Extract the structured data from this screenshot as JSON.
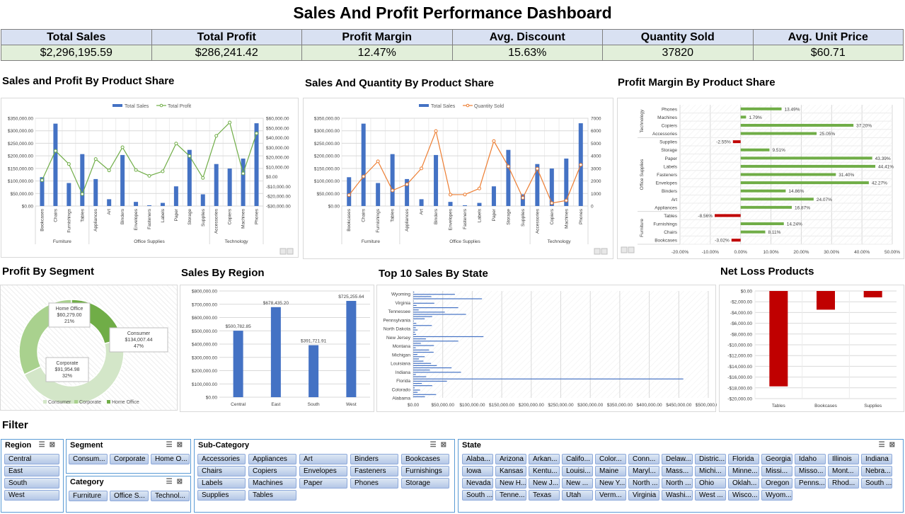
{
  "title": "Sales And Profit Performance Dashboard",
  "kpis": [
    {
      "label": "Total Sales",
      "value": "$2,296,195.59"
    },
    {
      "label": "Total Profit",
      "value": "$286,241.42"
    },
    {
      "label": "Profit Margin",
      "value": "12.47%"
    },
    {
      "label": "Avg. Discount",
      "value": "15.63%"
    },
    {
      "label": "Quantity Sold",
      "value": "37820"
    },
    {
      "label": "Avg. Unit Price",
      "value": "$60.71"
    }
  ],
  "sections": {
    "sp_share": "Sales and Profit By Product Share",
    "sq_share": "Sales And Quantity By Product Share",
    "pm_share": "Profit Margin By Product Share",
    "segment": "Profit By Segment",
    "region": "Sales By Region",
    "state": "Top 10 Sales By State",
    "netloss": "Net Loss Products",
    "filter": "Filter"
  },
  "chart_data": [
    {
      "type": "bar",
      "title": "",
      "legend": [
        "Total Sales",
        "Total Profit"
      ],
      "legend_position": "top",
      "categories": [
        "Bookcases",
        "Chairs",
        "Furnishings",
        "Tables",
        "Appliances",
        "Art",
        "Binders",
        "Envelopes",
        "Fasteners",
        "Labels",
        "Paper",
        "Storage",
        "Supplies",
        "Accessories",
        "Copiers",
        "Machines",
        "Phones"
      ],
      "groups": [
        {
          "name": "Furniture",
          "count": 4
        },
        {
          "name": "Office Supplies",
          "count": 9
        },
        {
          "name": "Technology",
          "count": 4
        }
      ],
      "series": [
        {
          "name": "Total Sales",
          "type": "bar",
          "values": [
            114880,
            328449,
            91705,
            206966,
            107532,
            27119,
            203413,
            16476,
            3024,
            12486,
            78479,
            223844,
            46674,
            167380,
            149528,
            189239,
            330007
          ]
        },
        {
          "name": "Total Profit",
          "type": "line",
          "axis": "right",
          "values": [
            -3473,
            26590,
            13059,
            -17725,
            18138,
            6528,
            30222,
            6964,
            950,
            5546,
            34054,
            21279,
            -1189,
            41937,
            55618,
            3385,
            44516
          ]
        }
      ],
      "y_ticks": [
        "$0.00",
        "$50,000.00",
        "$100,000.00",
        "$150,000.00",
        "$200,000.00",
        "$250,000.00",
        "$300,000.00",
        "$350,000.00"
      ],
      "ylim": [
        0,
        350000
      ],
      "y2_ticks": [
        "-$30,000.00",
        "-$20,000.00",
        "-$10,000.00",
        "$0.00",
        "$10,000.00",
        "$20,000.00",
        "$30,000.00",
        "$40,000.00",
        "$50,000.00",
        "$60,000.00"
      ],
      "y2lim": [
        -30000,
        60000
      ],
      "colors": [
        "#4472c4",
        "#70ad47"
      ]
    },
    {
      "type": "bar",
      "title": "",
      "legend": [
        "Total Sales",
        "Quantity Sold"
      ],
      "legend_position": "top",
      "categories": [
        "Bookcases",
        "Chairs",
        "Furnishings",
        "Tables",
        "Appliances",
        "Art",
        "Binders",
        "Envelopes",
        "Fasteners",
        "Labels",
        "Paper",
        "Storage",
        "Supplies",
        "Accessories",
        "Copiers",
        "Machines",
        "Phones"
      ],
      "groups": [
        {
          "name": "Furniture",
          "count": 4
        },
        {
          "name": "Office Supplies",
          "count": 9
        },
        {
          "name": "Technology",
          "count": 4
        }
      ],
      "series": [
        {
          "name": "Total Sales",
          "type": "bar",
          "values": [
            114880,
            328449,
            91705,
            206966,
            107532,
            27119,
            203413,
            16476,
            3024,
            12486,
            78479,
            223844,
            46674,
            167380,
            149528,
            189239,
            330007
          ]
        },
        {
          "name": "Quantity Sold",
          "type": "line",
          "axis": "right",
          "values": [
            868,
            2356,
            3563,
            1241,
            1729,
            3000,
            5974,
            906,
            914,
            1400,
            5178,
            3158,
            647,
            2976,
            234,
            440,
            3289
          ]
        }
      ],
      "y_ticks": [
        "$0.00",
        "$50,000.00",
        "$100,000.00",
        "$150,000.00",
        "$200,000.00",
        "$250,000.00",
        "$300,000.00",
        "$350,000.00"
      ],
      "ylim": [
        0,
        350000
      ],
      "y2_ticks": [
        "0",
        "1000",
        "2000",
        "3000",
        "4000",
        "5000",
        "6000",
        "7000"
      ],
      "y2lim": [
        0,
        7000
      ],
      "colors": [
        "#4472c4",
        "#ed7d31"
      ]
    },
    {
      "type": "bar",
      "orientation": "horizontal",
      "title": "",
      "groups": [
        {
          "name": "Technology",
          "items": [
            {
              "label": "Phones",
              "value": 13.49,
              "text": "13.49%"
            },
            {
              "label": "Machines",
              "value": 1.79,
              "text": "1.79%"
            },
            {
              "label": "Copiers",
              "value": 37.2,
              "text": "37.20%"
            },
            {
              "label": "Accessories",
              "value": 25.05,
              "text": "25.05%"
            }
          ]
        },
        {
          "name": "Office Supplies",
          "items": [
            {
              "label": "Supplies",
              "value": -2.55,
              "text": "-2.55%"
            },
            {
              "label": "Storage",
              "value": 9.51,
              "text": "9.51%"
            },
            {
              "label": "Paper",
              "value": 43.39,
              "text": "43.39%"
            },
            {
              "label": "Labels",
              "value": 44.41,
              "text": "44.41%"
            },
            {
              "label": "Fasteners",
              "value": 31.4,
              "text": "31.40%"
            },
            {
              "label": "Envelopes",
              "value": 42.27,
              "text": "42.27%"
            },
            {
              "label": "Binders",
              "value": 14.86,
              "text": "14.86%"
            },
            {
              "label": "Art",
              "value": 24.07,
              "text": "24.07%"
            },
            {
              "label": "Appliances",
              "value": 16.87,
              "text": "16.87%"
            }
          ]
        },
        {
          "name": "Furniture",
          "items": [
            {
              "label": "Tables",
              "value": -8.56,
              "text": "-8.56%"
            },
            {
              "label": "Furnishings",
              "value": 14.24,
              "text": "14.24%"
            },
            {
              "label": "Chairs",
              "value": 8.11,
              "text": "8.11%"
            },
            {
              "label": "Bookcases",
              "value": -3.02,
              "text": "-3.02%"
            }
          ]
        }
      ],
      "x_ticks": [
        "-20.00%",
        "-10.00%",
        "0.00%",
        "10.00%",
        "20.00%",
        "30.00%",
        "40.00%",
        "50.00%"
      ],
      "xlim": [
        -20,
        50
      ],
      "colors": [
        "#70ad47",
        "#c00000"
      ]
    },
    {
      "type": "pie",
      "donut": true,
      "title": "",
      "slices": [
        {
          "name": "Consumer",
          "value": 134007.44,
          "label": "Consumer, $134,007.44, 47%",
          "color": "#d3e6c8"
        },
        {
          "name": "Corporate",
          "value": 91954.98,
          "label": "Corporate, $91,954.98, 32%",
          "color": "#a9d18e"
        },
        {
          "name": "Home Office",
          "value": 60279.0,
          "label": "Home Office, $60,279.00, 21%",
          "color": "#70ad47"
        }
      ],
      "legend": [
        "Consumer",
        "Corporate",
        "Home Office"
      ],
      "legend_position": "bottom"
    },
    {
      "type": "bar",
      "title": "",
      "categories": [
        "Central",
        "East",
        "South",
        "West"
      ],
      "values": [
        500782.85,
        678435.2,
        391721.91,
        725255.64
      ],
      "labels": [
        "$500,782.85",
        "$678,435.20",
        "$391,721.91",
        "$725,255.64"
      ],
      "y_ticks": [
        "$0.00",
        "$100,000.00",
        "$200,000.00",
        "$300,000.00",
        "$400,000.00",
        "$500,000.00",
        "$600,000.00",
        "$700,000.00",
        "$800,000.00"
      ],
      "ylim": [
        0,
        800000
      ],
      "colors": [
        "#4472c4"
      ]
    },
    {
      "type": "bar",
      "orientation": "horizontal",
      "title": "",
      "labeled_categories": [
        "Wyoming",
        "Virginia",
        "Tennessee",
        "Pennsylvania",
        "North Dakota",
        "New Jersey",
        "Montana",
        "Michigan",
        "Louisiana",
        "Indiana",
        "Florida",
        "Colorado",
        "Alabama"
      ],
      "values": [
        1604,
        70637,
        30662,
        116512,
        920,
        35764,
        5589,
        76270,
        9217,
        53555,
        89474,
        32108,
        19511,
        1067,
        5197,
        31584,
        4382,
        7466,
        3047,
        4784,
        119004,
        21490,
        76381,
        12830,
        35083,
        4284,
        26963,
        34566,
        6991,
        19399,
        9683,
        17335,
        30142,
        40007,
        65005,
        28212,
        81004,
        4474,
        22032,
        457688,
        57152,
        14611,
        32200,
        2591,
        11624,
        7465,
        38753,
        19911
      ],
      "x_ticks": [
        "$0.00",
        "$50,000.00",
        "$100,000.00",
        "$150,000.00",
        "$200,000.00",
        "$250,000.00",
        "$300,000.00",
        "$350,000.00",
        "$400,000.00",
        "$450,000.00",
        "$500,000.00"
      ],
      "xlim": [
        0,
        500000
      ],
      "colors": [
        "#4472c4"
      ]
    },
    {
      "type": "bar",
      "title": "",
      "categories": [
        "Tables",
        "Bookcases",
        "Supplies"
      ],
      "values": [
        -17725,
        -3473,
        -1189
      ],
      "y_ticks": [
        "$0.00",
        "-$2,000.00",
        "-$4,000.00",
        "-$6,000.00",
        "-$8,000.00",
        "-$10,000.00",
        "-$12,000.00",
        "-$14,000.00",
        "-$16,000.00",
        "-$18,000.00",
        "-$20,000.00"
      ],
      "ylim": [
        -20000,
        0
      ],
      "colors": [
        "#c00000"
      ]
    }
  ],
  "slicers": {
    "region": {
      "title": "Region",
      "items": [
        "Central",
        "East",
        "South",
        "West"
      ]
    },
    "segment": {
      "title": "Segment",
      "items": [
        "Consum...",
        "Corporate",
        "Home O..."
      ]
    },
    "category": {
      "title": "Category",
      "items": [
        "Furniture",
        "Office S...",
        "Technol..."
      ]
    },
    "subcategory": {
      "title": "Sub-Category",
      "items": [
        "Accessories",
        "Appliances",
        "Art",
        "Binders",
        "Bookcases",
        "Chairs",
        "Copiers",
        "Envelopes",
        "Fasteners",
        "Furnishings",
        "Labels",
        "Machines",
        "Paper",
        "Phones",
        "Storage",
        "Supplies",
        "Tables"
      ]
    },
    "state": {
      "title": "State",
      "items": [
        "Alaba...",
        "Arizona",
        "Arkan...",
        "Califo...",
        "Color...",
        "Conn...",
        "Delaw...",
        "Distric...",
        "Florida",
        "Georgia",
        "Idaho",
        "Illinois",
        "Indiana",
        "Iowa",
        "Kansas",
        "Kentu...",
        "Louisi...",
        "Maine",
        "Maryl...",
        "Mass...",
        "Michi...",
        "Minne...",
        "Missi...",
        "Misso...",
        "Mont...",
        "Nebra...",
        "Nevada",
        "New H...",
        "New J...",
        "New ...",
        "New Y...",
        "North ...",
        "North ...",
        "Ohio",
        "Oklah...",
        "Oregon",
        "Penns...",
        "Rhod...",
        "South ...",
        "South ...",
        "Tenne...",
        "Texas",
        "Utah",
        "Verm...",
        "Virginia",
        "Washi...",
        "West ...",
        "Wisco...",
        "Wyom..."
      ]
    }
  }
}
